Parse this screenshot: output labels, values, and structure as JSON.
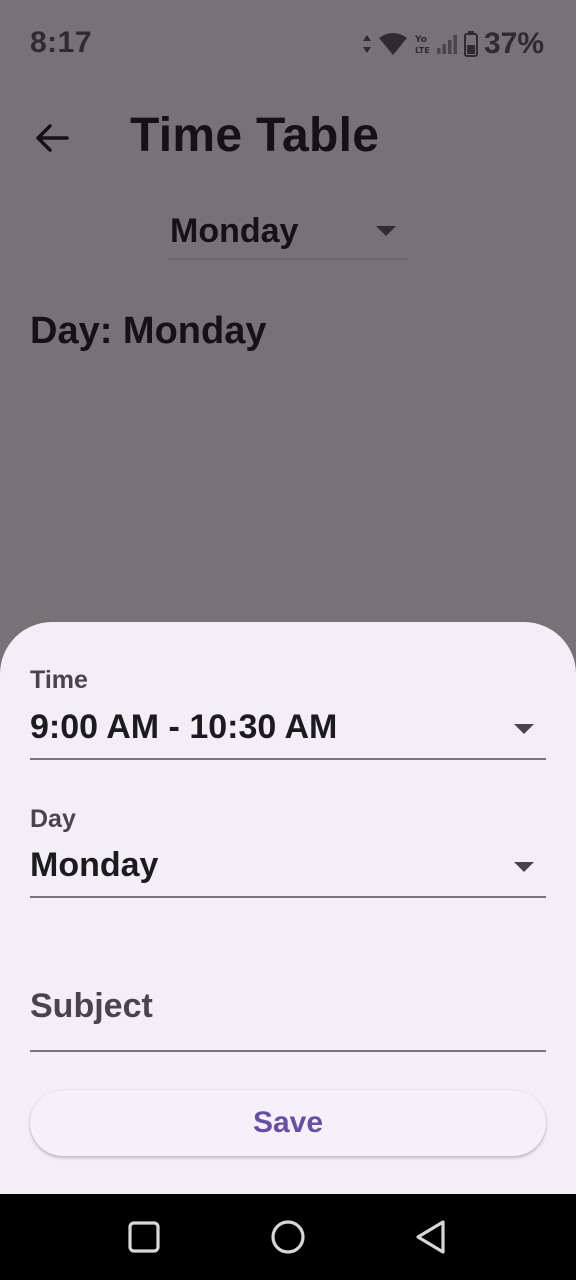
{
  "status_bar": {
    "time": "8:17",
    "battery_percent": "37%",
    "icons": [
      "data-arrows-icon",
      "wifi-icon",
      "volte-icon",
      "signal-icon",
      "battery-icon"
    ]
  },
  "app_bar": {
    "back_icon": "arrow-left-icon",
    "title": "Time Table"
  },
  "day_selector": {
    "selected": "Monday"
  },
  "day_heading": "Day: Monday",
  "sheet": {
    "time_field": {
      "label": "Time",
      "value": "9:00 AM - 10:30 AM"
    },
    "day_field": {
      "label": "Day",
      "value": "Monday"
    },
    "subject_field": {
      "placeholder": "Subject",
      "value": ""
    },
    "save_label": "Save"
  },
  "nav_bar": {
    "buttons": [
      "recents-square-icon",
      "home-circle-icon",
      "back-triangle-icon"
    ]
  },
  "colors": {
    "scrim_background": "#767276",
    "sheet_background": "#f4eff7",
    "accent": "#6750a4",
    "nav_bar": "#000000"
  }
}
